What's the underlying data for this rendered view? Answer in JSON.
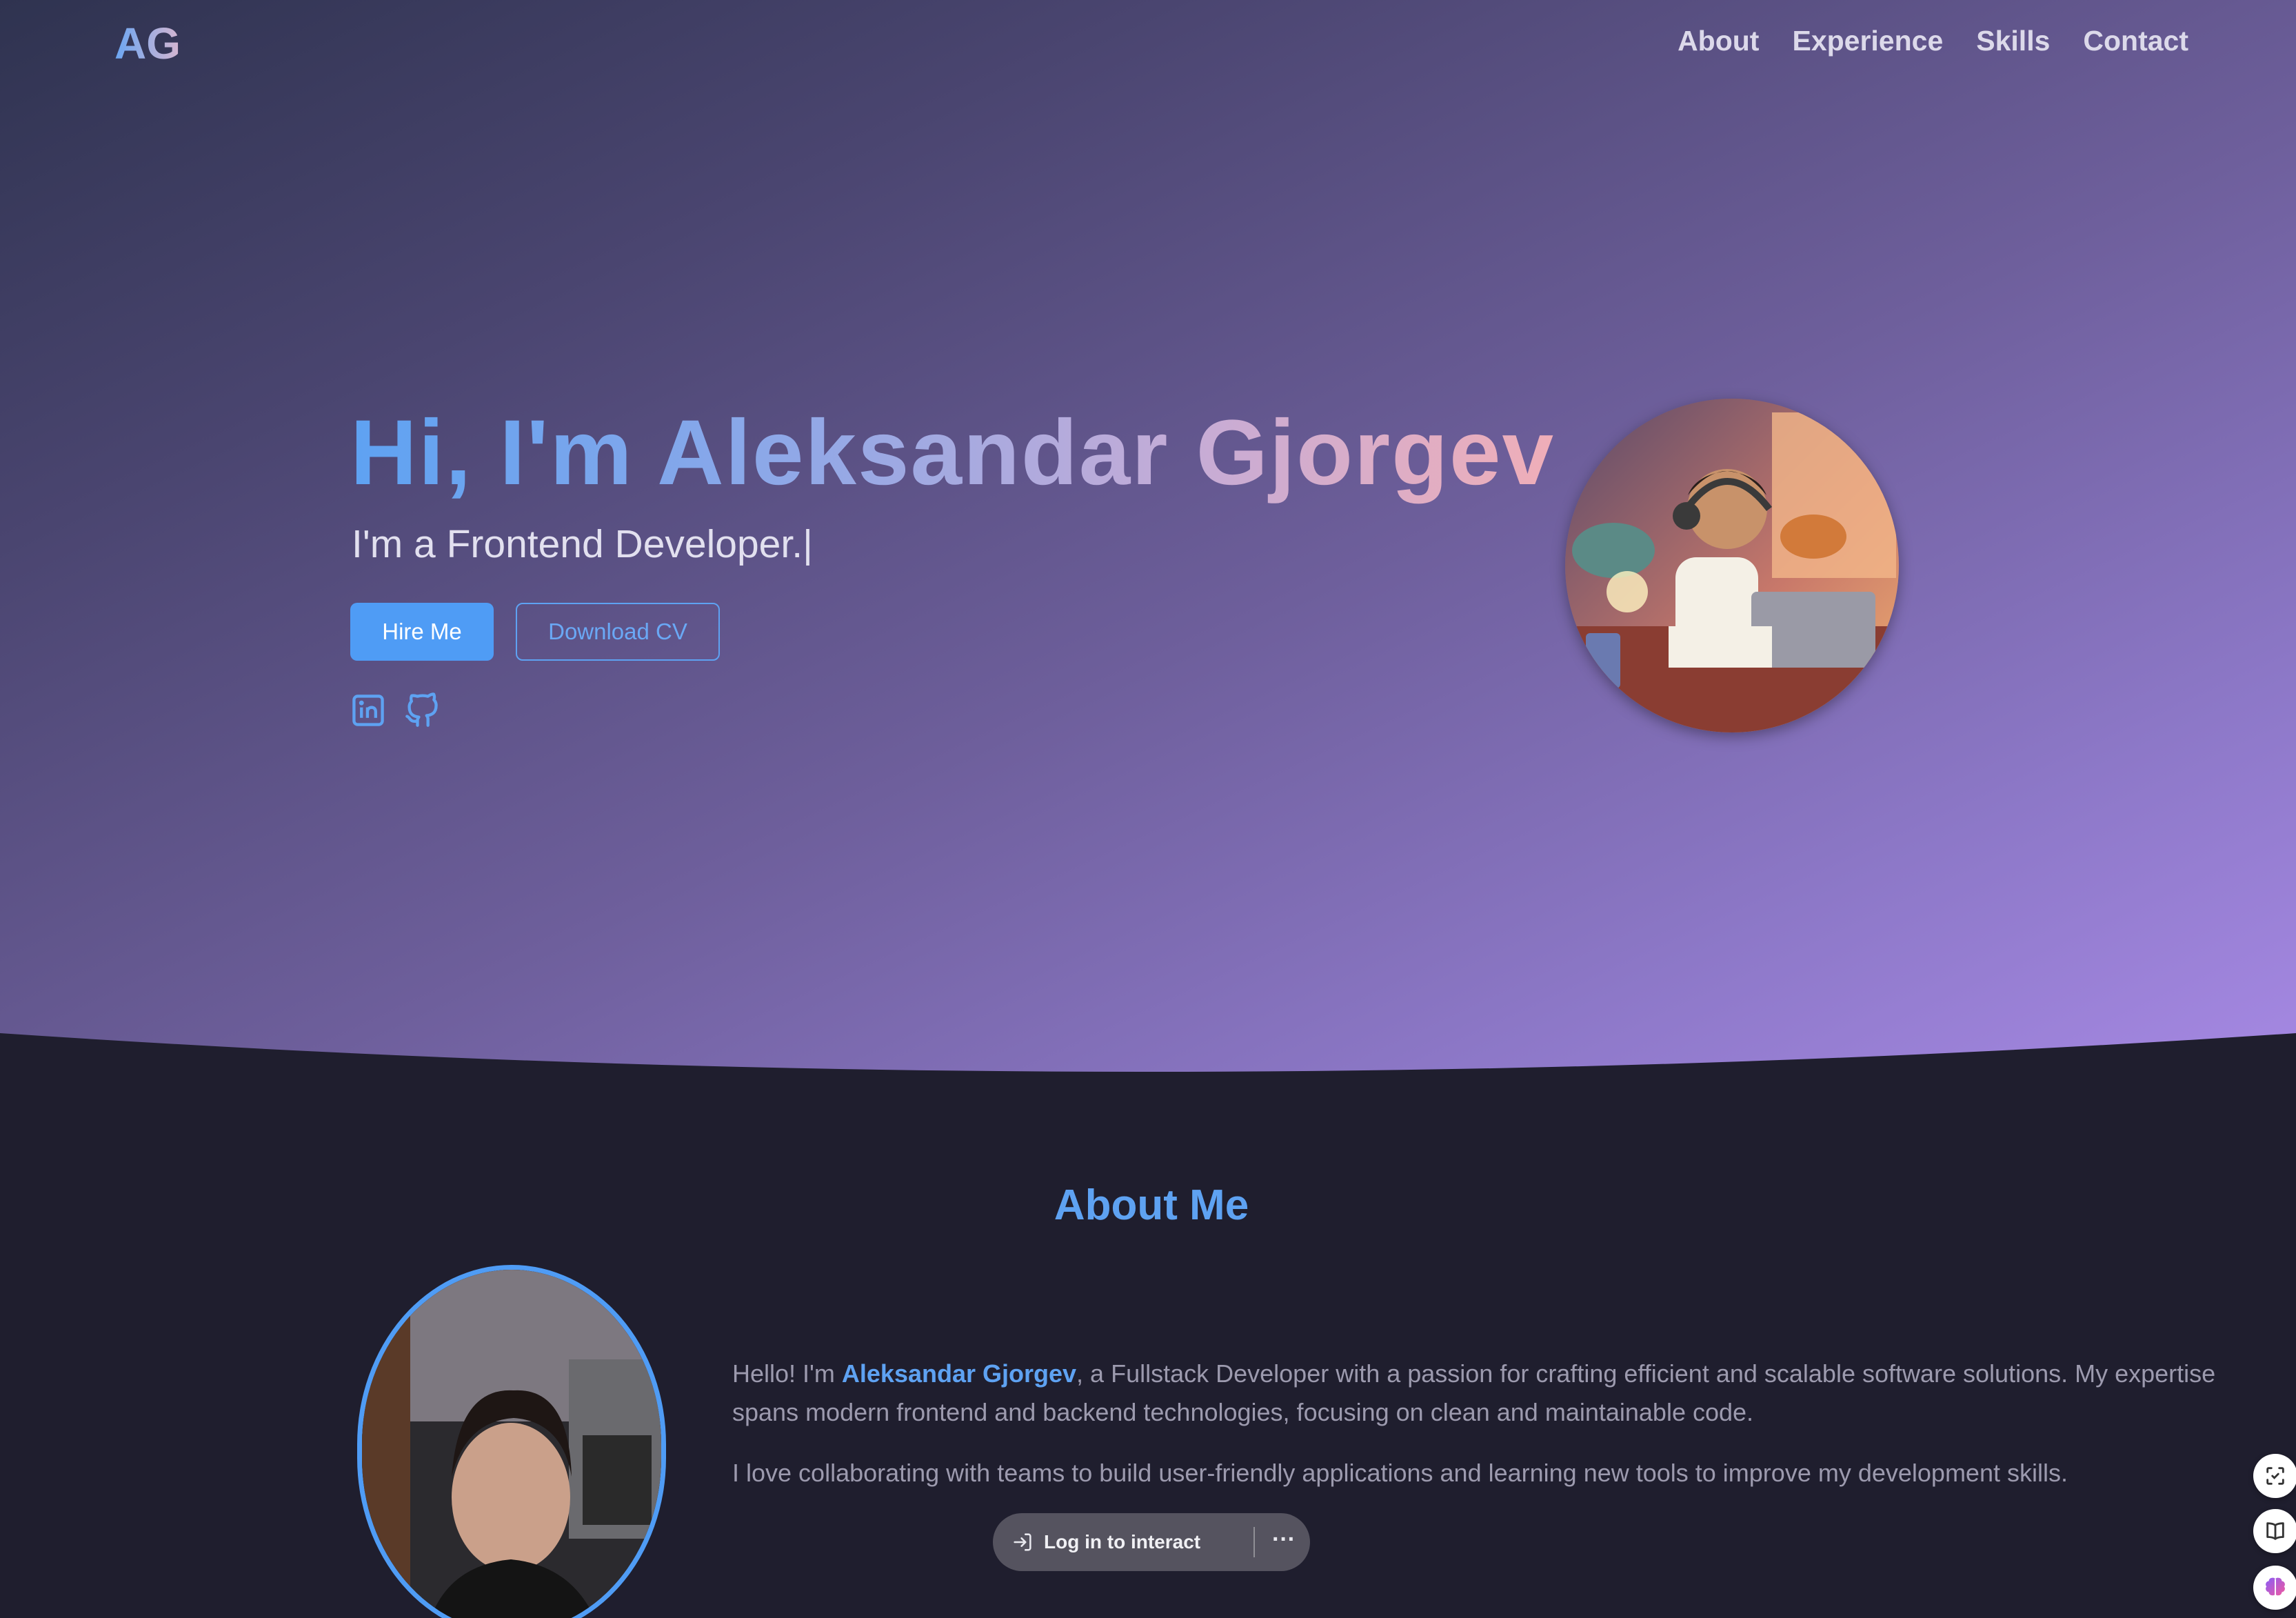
{
  "header": {
    "logo": "AG",
    "nav": [
      "About",
      "Experience",
      "Skills",
      "Contact"
    ]
  },
  "hero": {
    "title": "Hi, I'm Aleksandar Gjorgev",
    "subtitle": "I'm a Frontend Developer.",
    "caret": "|",
    "hire_label": "Hire Me",
    "cv_label": "Download CV",
    "social_icons": [
      "linkedin-icon",
      "github-icon"
    ]
  },
  "about": {
    "title": "About Me",
    "p1_prefix": "Hello! I'm ",
    "p1_name": "Aleksandar Gjorgev",
    "p1_suffix": ", a Fullstack Developer with a passion for crafting efficient and scalable software solutions. My expertise spans modern frontend and backend technologies, focusing on clean and maintainable code.",
    "p2": "I love collaborating with teams to build user-friendly applications and learning new tools to improve my development skills."
  },
  "overlay": {
    "login_label": "Log in to interact",
    "more_label": "···"
  },
  "colors": {
    "accent": "#4f9cf5",
    "page_bg": "#1f1e2e",
    "hero_start": "#2f3350",
    "hero_end": "#a88ae6"
  }
}
